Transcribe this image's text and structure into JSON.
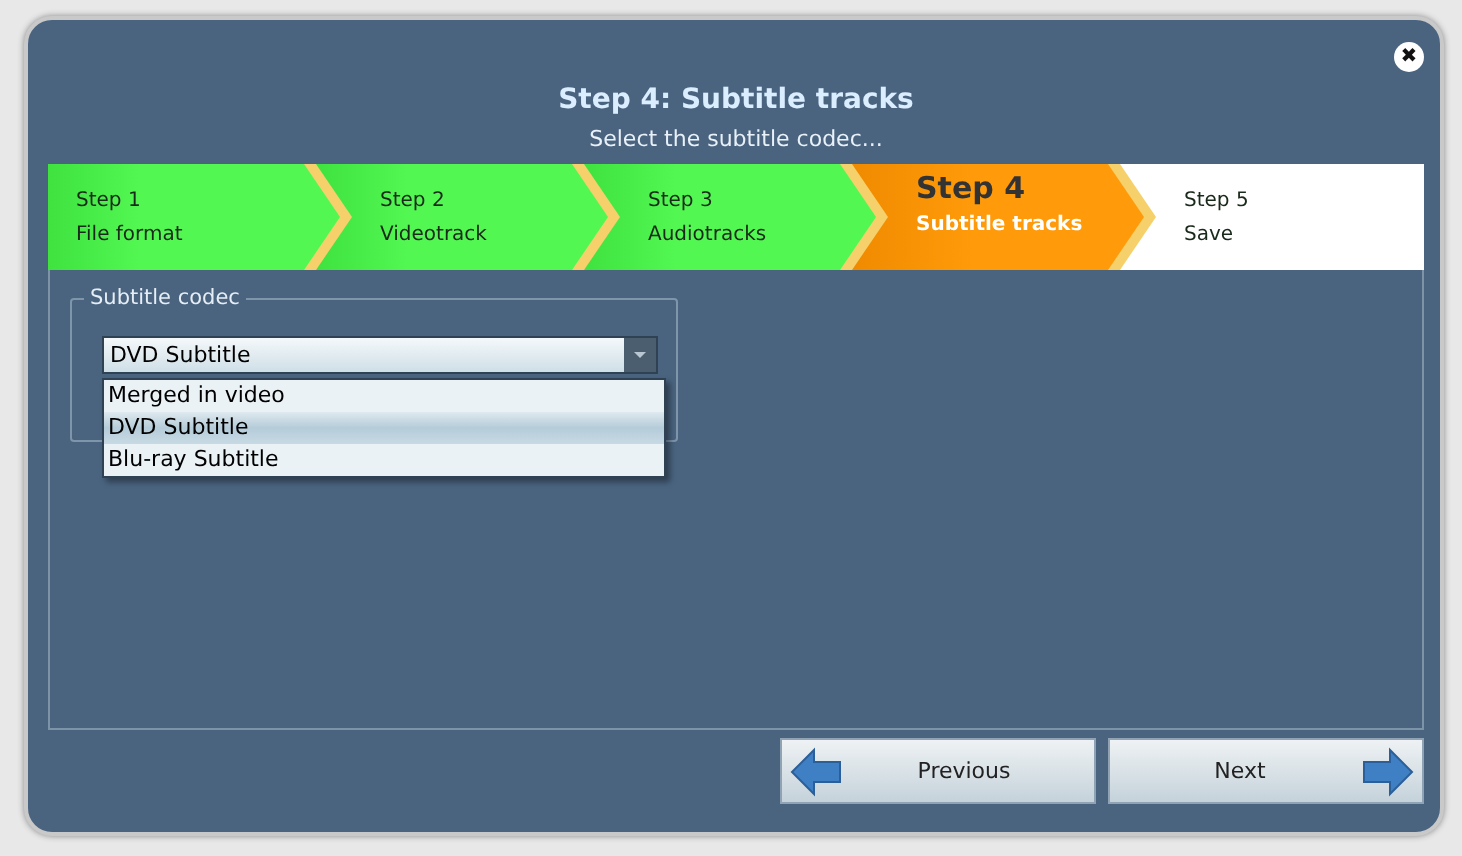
{
  "window": {
    "title": "Step 4: Subtitle tracks",
    "subtitle": "Select the subtitle codec...",
    "close_icon": "✖"
  },
  "steps": [
    {
      "number": "Step 1",
      "label": "File format",
      "kind": "done"
    },
    {
      "number": "Step 2",
      "label": "Videotrack",
      "kind": "done"
    },
    {
      "number": "Step 3",
      "label": "Audiotracks",
      "kind": "done"
    },
    {
      "number": "Step 4",
      "label": "Subtitle tracks",
      "kind": "current"
    },
    {
      "number": "Step 5",
      "label": "Save",
      "kind": "pending"
    }
  ],
  "subtitle_codec": {
    "legend": "Subtitle codec",
    "value": "DVD Subtitle",
    "options": [
      {
        "label": "Merged in video",
        "selected": false
      },
      {
        "label": "DVD Subtitle",
        "selected": true
      },
      {
        "label": "Blu-ray Subtitle",
        "selected": false
      }
    ]
  },
  "buttons": [
    {
      "label": "Previous",
      "kind": "previous"
    },
    {
      "label": "Next",
      "kind": "next"
    }
  ]
}
